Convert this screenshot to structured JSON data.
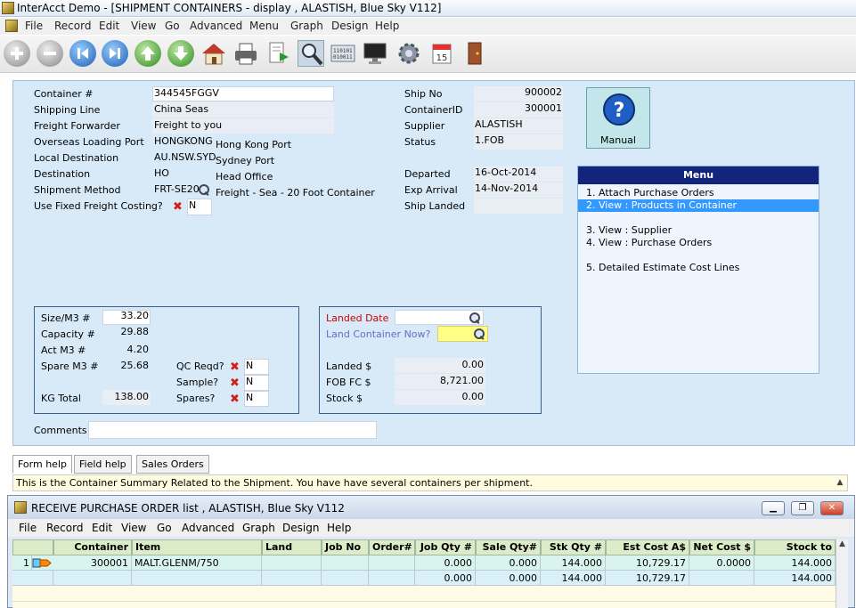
{
  "window": {
    "title": "InterAcct Demo - [SHIPMENT CONTAINERS - display , ALASTISH, Blue Sky V112]"
  },
  "menubar": [
    "File",
    "Record",
    "Edit",
    "View",
    "Go",
    "Advanced",
    "Menu",
    "Graph",
    "Design",
    "Help"
  ],
  "toolbar": {
    "icons": [
      "plus-icon",
      "minus-icon",
      "first-icon",
      "last-icon",
      "up-icon",
      "down-icon",
      "home-icon",
      "print-icon",
      "export-icon",
      "search-icon",
      "data-icon",
      "monitor-icon",
      "settings-icon",
      "calendar-icon",
      "exit-door-icon"
    ],
    "calendar_day": "15"
  },
  "form": {
    "container_no": {
      "label": "Container #",
      "value": "344545FGGV"
    },
    "shipping_line": {
      "label": "Shipping Line",
      "value": "China Seas"
    },
    "freight_forwarder": {
      "label": "Freight Forwarder",
      "value": "Freight to you"
    },
    "overseas_port": {
      "label": "Overseas Loading Port",
      "code": "HONGKONG",
      "name": "Hong Kong Port"
    },
    "local_dest": {
      "label": "Local Destination",
      "code": "AU.NSW.SYD",
      "name": "Sydney Port"
    },
    "destination": {
      "label": "Destination",
      "code": "HO",
      "name": "Head Office"
    },
    "shipment_method": {
      "label": "Shipment Method",
      "code": "FRT-SE20",
      "name": "Freight - Sea - 20 Foot Container"
    },
    "fixed_freight": {
      "label": "Use Fixed Freight Costing?",
      "value": "N"
    },
    "ship_no": {
      "label": "Ship No",
      "value": "900002"
    },
    "container_id": {
      "label": "ContainerID",
      "value": "300001"
    },
    "supplier": {
      "label": "Supplier",
      "value": "ALASTISH"
    },
    "status": {
      "label": "Status",
      "value": "1.FOB"
    },
    "departed": {
      "label": "Departed",
      "value": "16-Oct-2014"
    },
    "exp_arrival": {
      "label": "Exp Arrival",
      "value": "14-Nov-2014"
    },
    "ship_landed": {
      "label": "Ship Landed",
      "value": ""
    },
    "manual_label": "Manual",
    "size": {
      "label": "Size/M3 #",
      "value": "33.20"
    },
    "capacity": {
      "label": "Capacity #",
      "value": "29.88"
    },
    "act": {
      "label": "Act M3 #",
      "value": "4.20"
    },
    "spare": {
      "label": "Spare M3 #",
      "value": "25.68"
    },
    "kg_total": {
      "label": "KG Total",
      "value": "138.00"
    },
    "qc_reqd": {
      "label": "QC Reqd?",
      "value": "N"
    },
    "sample": {
      "label": "Sample?",
      "value": "N"
    },
    "spares": {
      "label": "Spares?",
      "value": "N"
    },
    "landed_date": {
      "label": "Landed Date",
      "value": ""
    },
    "land_container": {
      "label": "Land Container Now?",
      "value": ""
    },
    "landed_amt": {
      "label": "Landed $",
      "value": "0.00"
    },
    "fob_fc": {
      "label": "FOB FC $",
      "value": "8,721.00"
    },
    "stock_amt": {
      "label": "Stock $",
      "value": "0.00"
    },
    "comments": {
      "label": "Comments",
      "value": ""
    },
    "colors": {
      "panel": "#d8eaf8",
      "menu_head": "#12257a",
      "menu_sel": "#3399ff",
      "landed_label": "#cc0000",
      "land_now_label": "#6a6acb",
      "land_now_field": "#ffff88"
    }
  },
  "menu": {
    "title": "Menu",
    "items": [
      "1. Attach Purchase Orders",
      "2. View : Products in Container",
      "3. View : Supplier",
      "4. View : Purchase Orders",
      "5. Detailed Estimate Cost Lines"
    ]
  },
  "tabs": [
    "Form help",
    "Field help",
    "Sales Orders"
  ],
  "help_text": "This is the Container Summary Related to the Shipment. You have have several containers per shipment.",
  "child": {
    "title": "RECEIVE PURCHASE ORDER list , ALASTISH, Blue Sky V112",
    "menubar": [
      "File",
      "Record",
      "Edit",
      "View",
      "Go",
      "Advanced",
      "Graph",
      "Design",
      "Help"
    ],
    "columns": [
      "Container No",
      "Item",
      "Land Now?",
      "Job No",
      "Order#",
      "Job Qty #",
      "Sale Qty#",
      "Stk Qty #",
      "Est Cost A$",
      "Net Cost $",
      "Stock to Come"
    ],
    "rows": [
      {
        "num": "1",
        "container": "300001",
        "item": "MALT.GLENM/750",
        "land": "",
        "job": "",
        "order": "",
        "jobqty": "0.000",
        "saleqty": "0.000",
        "stkqty": "144.000",
        "estcost": "10,729.17",
        "netcost": "0.0000",
        "stock": "144.000"
      },
      {
        "num": "",
        "container": "",
        "item": "",
        "land": "",
        "job": "",
        "order": "",
        "jobqty": "0.000",
        "saleqty": "0.000",
        "stkqty": "144.000",
        "estcost": "10,729.17",
        "netcost": "",
        "stock": "144.000"
      }
    ]
  }
}
